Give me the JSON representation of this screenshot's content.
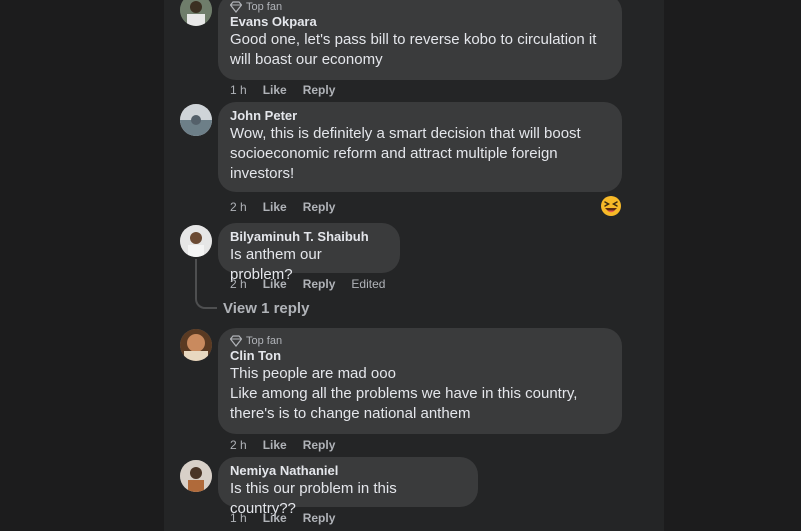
{
  "comments": [
    {
      "badge": "Top fan",
      "author": "Evans Okpara",
      "lines": [
        "Good one, let's pass bill to reverse kobo to circulation it",
        "will boast our economy"
      ],
      "time": "1 h",
      "like": "Like",
      "reply": "Reply"
    },
    {
      "author": "John Peter",
      "lines": [
        "Wow, this is definitely a smart decision that will boost",
        "socioeconomic reform and attract multiple foreign",
        "investors!"
      ],
      "time": "2 h",
      "like": "Like",
      "reply": "Reply",
      "reaction": "grinning-squint-emoji"
    },
    {
      "author": "Bilyaminuh T. Shaibuh",
      "lines": [
        "Is anthem our problem?"
      ],
      "time": "2 h",
      "like": "Like",
      "reply": "Reply",
      "edited": "Edited",
      "view_replies": "View 1 reply"
    },
    {
      "badge": "Top fan",
      "author": "Clin Ton",
      "lines": [
        "This people are mad ooo",
        "Like among all the problems we have in this country,",
        "there's is to change national anthem"
      ],
      "time": "2 h",
      "like": "Like",
      "reply": "Reply"
    },
    {
      "author": "Nemiya Nathaniel",
      "lines": [
        "Is this our problem in this country??"
      ],
      "time": "1 h",
      "like": "Like",
      "reply": "Reply"
    }
  ],
  "colors": {
    "background": "#1c1c1d",
    "panel": "#242526",
    "bubble": "#3a3b3c",
    "text": "#e4e6eb",
    "secondary_text": "#b0b3b8"
  }
}
